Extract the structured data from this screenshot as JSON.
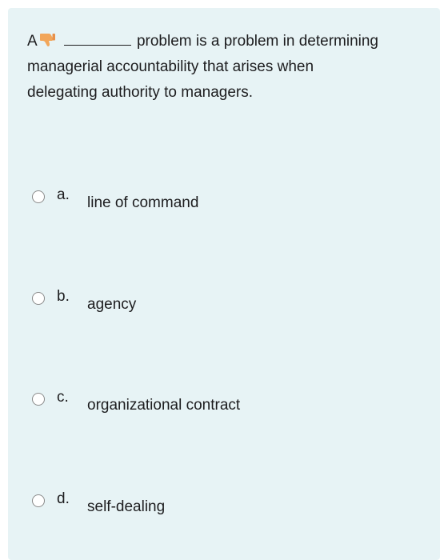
{
  "question": {
    "prefix": "A",
    "thumb_icon": "thumbs-down-icon",
    "line1_rest": "problem is a problem in determining",
    "line2": "managerial accountability that arises when",
    "line3": "delegating authority to managers."
  },
  "options": [
    {
      "letter": "a.",
      "text": "line of command"
    },
    {
      "letter": "b.",
      "text": "agency"
    },
    {
      "letter": "c.",
      "text": "organizational contract"
    },
    {
      "letter": "d.",
      "text": "self-dealing"
    }
  ],
  "colors": {
    "panel_background": "#e7f3f5",
    "text": "#1d1d1f",
    "thumb": "#f2a65a"
  }
}
